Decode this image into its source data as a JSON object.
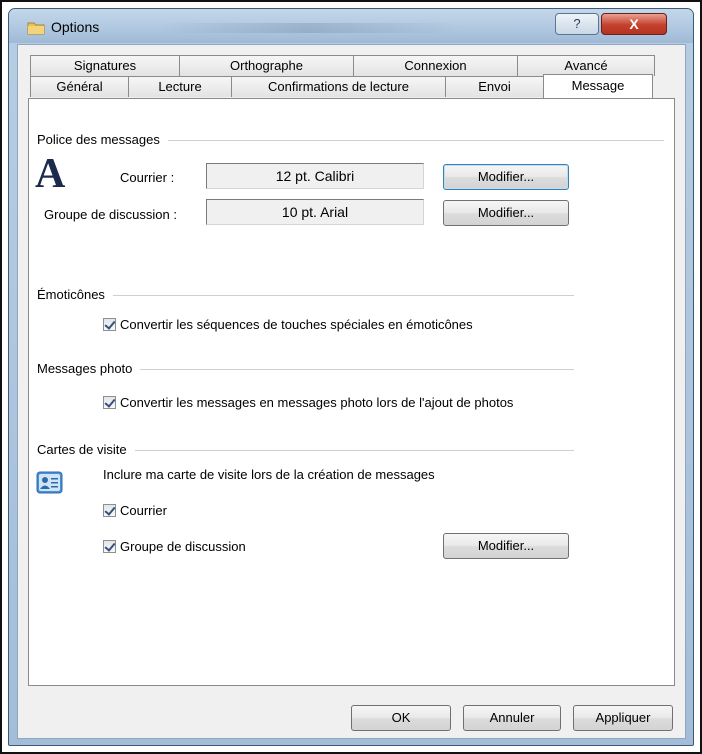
{
  "window": {
    "title": "Options",
    "help_glyph": "?",
    "close_glyph": "X"
  },
  "tabs_back": [
    "Signatures",
    "Orthographe",
    "Connexion",
    "Avancé"
  ],
  "tabs_front": [
    "Général",
    "Lecture",
    "Confirmations de lecture",
    "Envoi",
    "Message"
  ],
  "active_tab": "Message",
  "fonts_group": {
    "title": "Police des messages",
    "icon_glyph": "A",
    "mail_label": "Courrier :",
    "mail_value": "12 pt. Calibri",
    "news_label": "Groupe de discussion :",
    "news_value": "10 pt. Arial",
    "modify_label": "Modifier..."
  },
  "emoticons_group": {
    "title": "Émoticônes",
    "option": "Convertir les séquences de touches spéciales en émoticônes",
    "checked": true
  },
  "photo_group": {
    "title": "Messages photo",
    "option": "Convertir les messages en messages photo lors de l'ajout de photos",
    "checked": true
  },
  "vcard_group": {
    "title": "Cartes de visite",
    "description": "Inclure ma carte de visite lors de la création de messages",
    "mail": "Courrier",
    "mail_checked": true,
    "news": "Groupe de discussion",
    "news_checked": true,
    "modify_label": "Modifier..."
  },
  "footer": {
    "ok": "OK",
    "cancel": "Annuler",
    "apply": "Appliquer"
  }
}
